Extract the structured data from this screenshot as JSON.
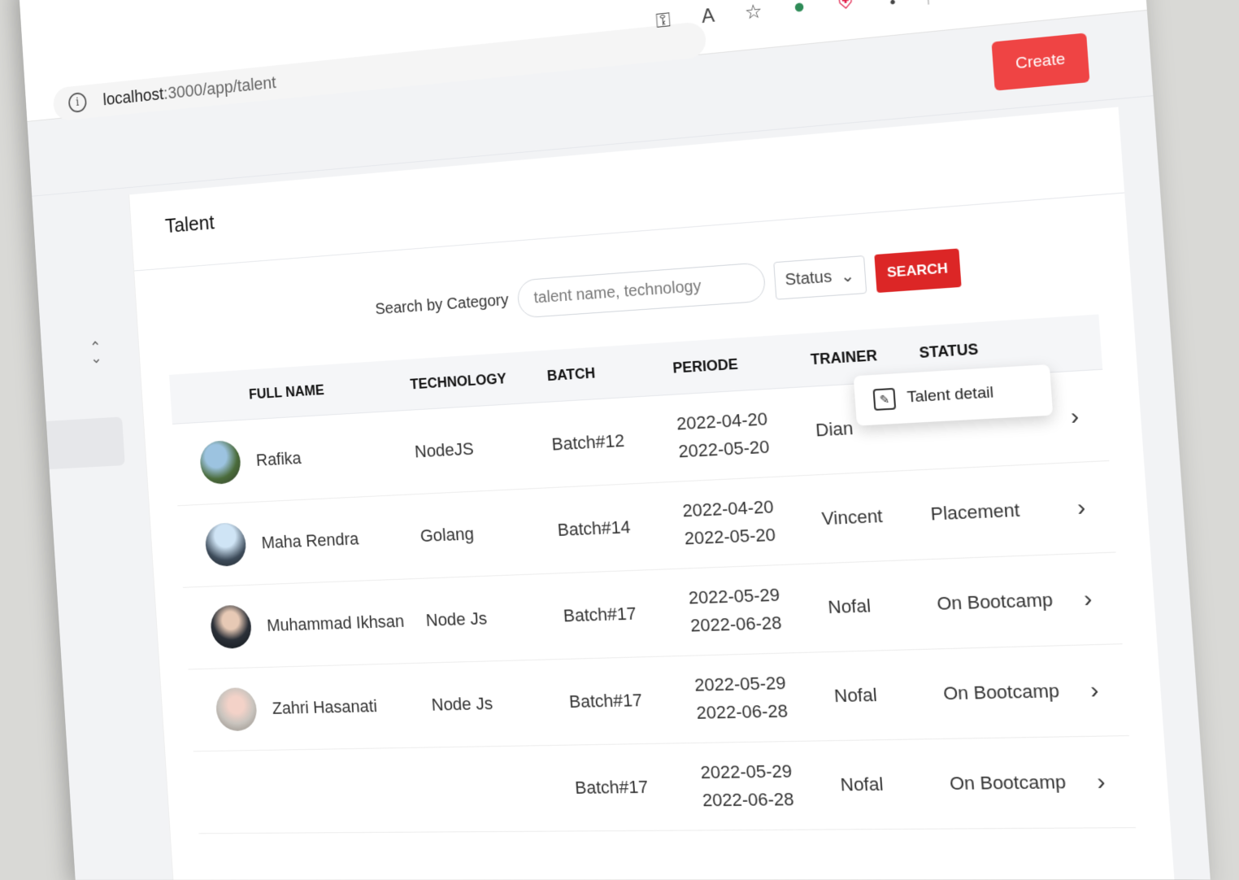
{
  "browser": {
    "url_host": "localhost",
    "url_path": ":3000/app/talent",
    "icons": [
      "key-icon",
      "read-aloud-icon",
      "favorite-add-icon",
      "extension-globe-icon",
      "shield-extension-icon",
      "puzzle-extensions-icon",
      "favorites-icon",
      "collections-icon",
      "profile-avatar"
    ]
  },
  "header": {
    "create_label": "Create"
  },
  "page": {
    "title": "Talent"
  },
  "search": {
    "label": "Search by Category",
    "placeholder": "talent name, technology",
    "status_label": "Status",
    "button_label": "SEARCH"
  },
  "table": {
    "columns": [
      "FULL NAME",
      "TECHNOLOGY",
      "BATCH",
      "PERIODE",
      "TRAINER",
      "STATUS"
    ],
    "rows": [
      {
        "name": "Rafika",
        "tech": "NodeJS",
        "batch": "Batch#12",
        "start": "2022-04-20",
        "end": "2022-05-20",
        "trainer": "Dian",
        "status": ""
      },
      {
        "name": "Maha Rendra",
        "tech": "Golang",
        "batch": "Batch#14",
        "start": "2022-04-20",
        "end": "2022-05-20",
        "trainer": "Vincent",
        "status": "Placement"
      },
      {
        "name": "Muhammad Ikhsan",
        "tech": "Node Js",
        "batch": "Batch#17",
        "start": "2022-05-29",
        "end": "2022-06-28",
        "trainer": "Nofal",
        "status": "On Bootcamp"
      },
      {
        "name": "Zahri Hasanati",
        "tech": "Node Js",
        "batch": "Batch#17",
        "start": "2022-05-29",
        "end": "2022-06-28",
        "trainer": "Nofal",
        "status": "On Bootcamp"
      },
      {
        "name": "",
        "tech": "",
        "batch": "Batch#17",
        "start": "2022-05-29",
        "end": "2022-06-28",
        "trainer": "Nofal",
        "status": "On Bootcamp"
      }
    ],
    "popup_label": "Talent detail"
  },
  "colors": {
    "accent": "#ef4444",
    "search_button": "#dc2626"
  }
}
